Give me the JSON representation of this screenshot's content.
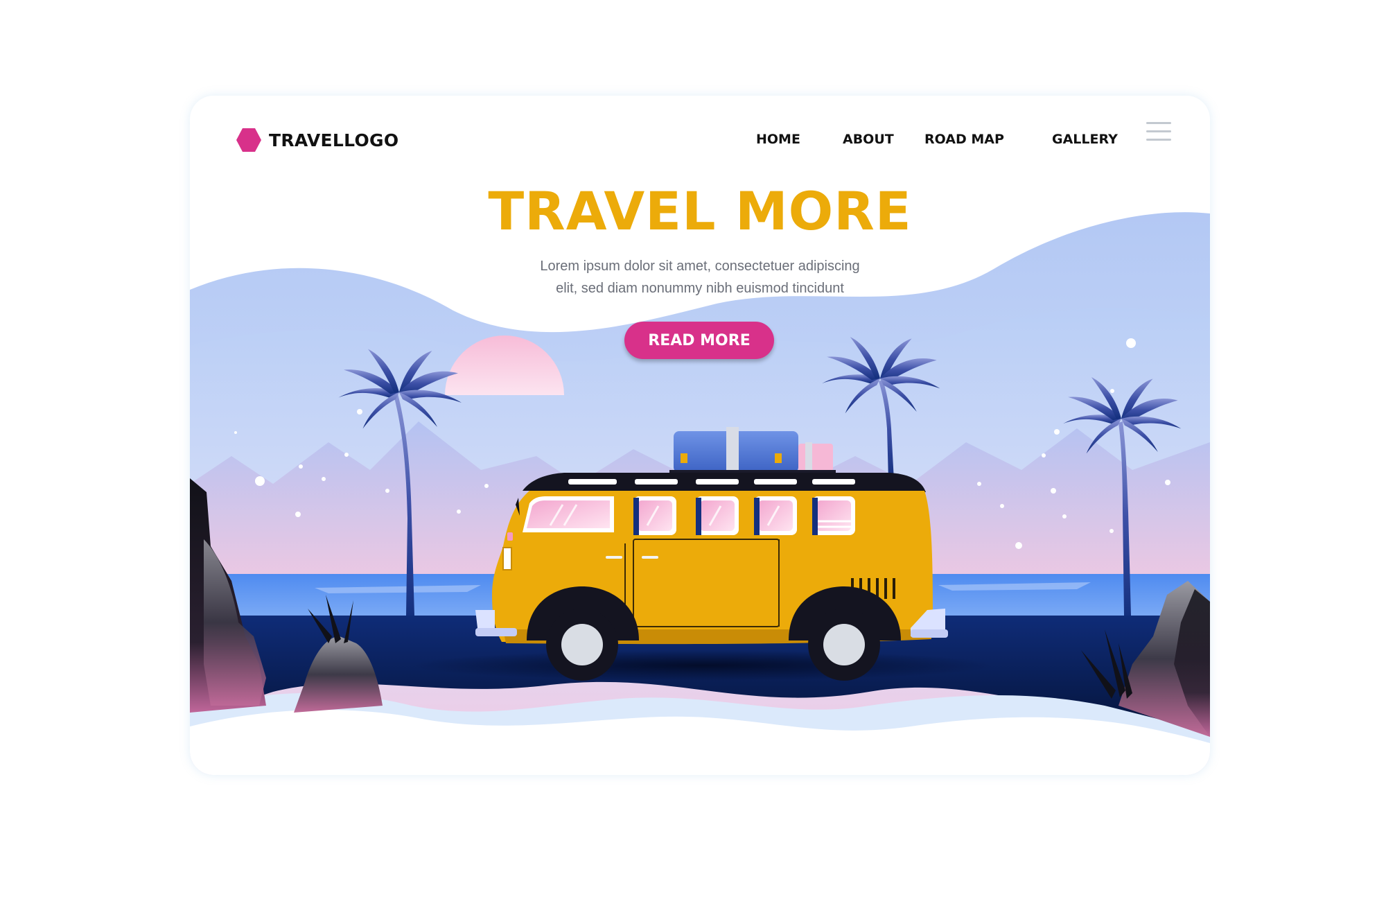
{
  "header": {
    "logo_text": "TRAVELLOGO",
    "logo_icon": "hexagon-icon",
    "menu_icon": "hamburger-menu-icon"
  },
  "nav": {
    "items": [
      {
        "label": "HOME"
      },
      {
        "label": "ABOUT"
      },
      {
        "label": "ROAD MAP"
      },
      {
        "label": "GALLERY"
      }
    ]
  },
  "hero": {
    "title": "TRAVEL MORE",
    "description_line1": "Lorem ipsum dolor sit amet, consectetuer adipiscing",
    "description_line2": "elit, sed diam nonummy nibh euismod tincidunt",
    "cta_label": "READ MORE"
  },
  "colors": {
    "accent": "#d8318a",
    "title": "#ecab0a",
    "van": "#ecab0a",
    "road": "#0d2a6e",
    "sea": "#5b93f0"
  }
}
